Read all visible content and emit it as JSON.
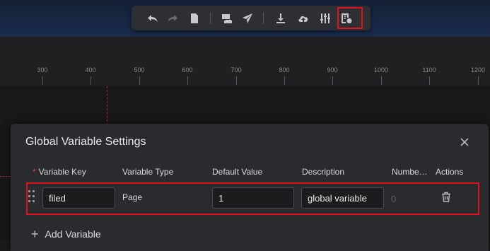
{
  "toolbar": {
    "buttons": [
      {
        "name": "undo-icon"
      },
      {
        "name": "redo-icon"
      },
      {
        "name": "save-icon"
      },
      {
        "name": "preview-icon"
      },
      {
        "name": "publish-icon"
      },
      {
        "name": "download-icon"
      },
      {
        "name": "upload-cloud-icon"
      },
      {
        "name": "settings-sliders-icon"
      },
      {
        "name": "global-variable-icon"
      }
    ],
    "highlight_color": "#e0131c"
  },
  "ruler": {
    "ticks": [
      "300",
      "400",
      "500",
      "600",
      "700",
      "800",
      "900",
      "1000",
      "1100",
      "1200"
    ]
  },
  "modal": {
    "title": "Global Variable Settings",
    "close_icon": "close-icon",
    "columns": {
      "required_mark": "*",
      "key": "Variable Key",
      "type": "Variable Type",
      "default": "Default Value",
      "description": "Description",
      "number": "Numbe…",
      "actions": "Actions"
    },
    "rows": [
      {
        "key": "filed",
        "type": "Page",
        "default": "1",
        "description": "global variable",
        "number": "0"
      }
    ],
    "add_variable": {
      "plus": "+",
      "label": "Add Variable"
    }
  }
}
